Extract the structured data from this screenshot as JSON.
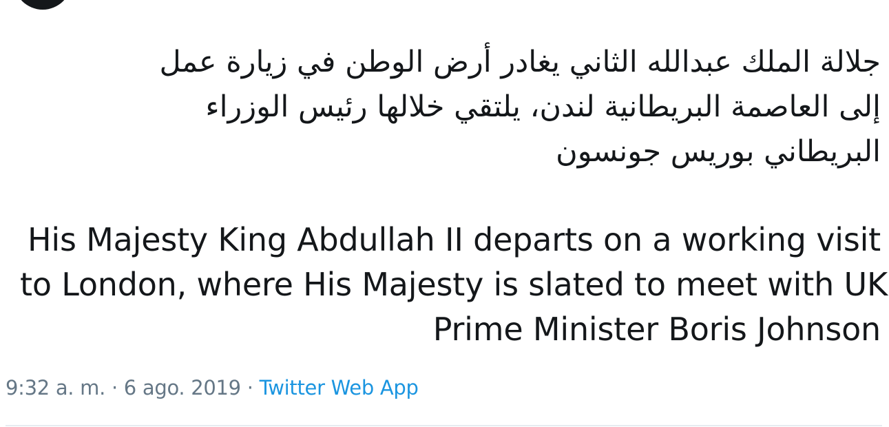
{
  "tweet": {
    "arabic_lines": [
      "جلالة الملك عبدالله الثاني يغادر أرض الوطن في زيارة عمل",
      "إلى العاصمة البريطانية لندن، يلتقي خلالها رئيس الوزراء",
      "البريطاني بوريس جونسون"
    ],
    "english_lines": [
      "His Majesty King Abdullah II departs on a working visit",
      "to London, where His Majesty is slated to meet with UK",
      "Prime Minister Boris Johnson"
    ],
    "time": "9:32 a. m.",
    "separator": " · ",
    "date": "6 ago. 2019",
    "source": "Twitter Web App"
  },
  "colors": {
    "text": "#14171a",
    "meta": "#657786",
    "link": "#1b95e0",
    "divider": "#e6ecf0"
  }
}
